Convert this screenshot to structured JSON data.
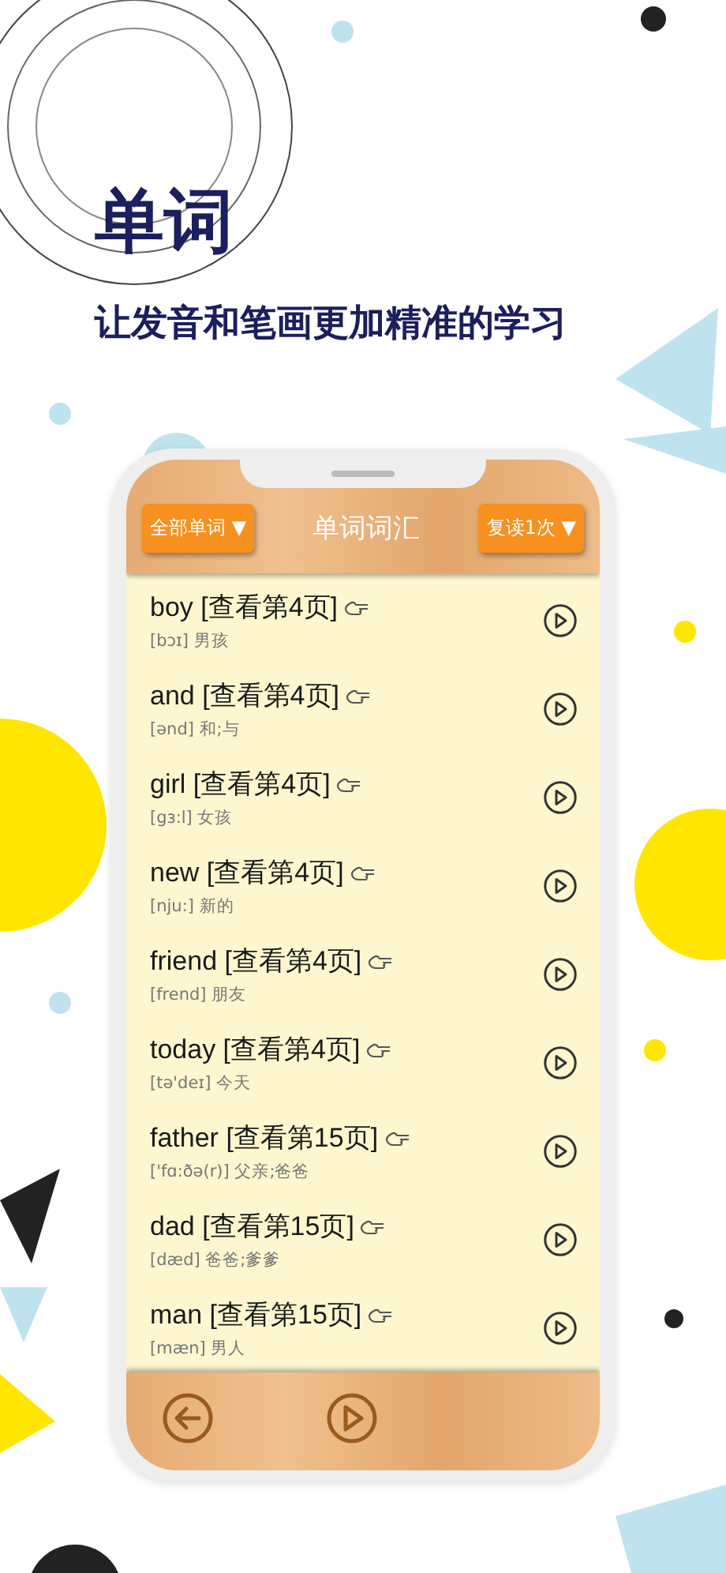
{
  "headline": "单词",
  "subtitle": "让发音和笔画更加精准的学习",
  "header": {
    "filter_button": "全部单词 ▼",
    "title": "单词词汇",
    "repeat_button": "复读1次 ▼"
  },
  "words": [
    {
      "word": "boy [查看第4页]",
      "detail": "[bɔɪ] 男孩"
    },
    {
      "word": "and [查看第4页]",
      "detail": "[ənd] 和;与"
    },
    {
      "word": "girl [查看第4页]",
      "detail": "[gɜ:l] 女孩"
    },
    {
      "word": "new [查看第4页]",
      "detail": "[nju:] 新的"
    },
    {
      "word": "friend [查看第4页]",
      "detail": "[frend] 朋友"
    },
    {
      "word": "today [查看第4页]",
      "detail": "[tə'deɪ] 今天"
    },
    {
      "word": "father [查看第15页]",
      "detail": "['fɑ:ðə(r)] 父亲;爸爸"
    },
    {
      "word": "dad [查看第15页]",
      "detail": "[dæd] 爸爸;爹爹"
    },
    {
      "word": "man [查看第15页]",
      "detail": "[mæn] 男人"
    }
  ]
}
